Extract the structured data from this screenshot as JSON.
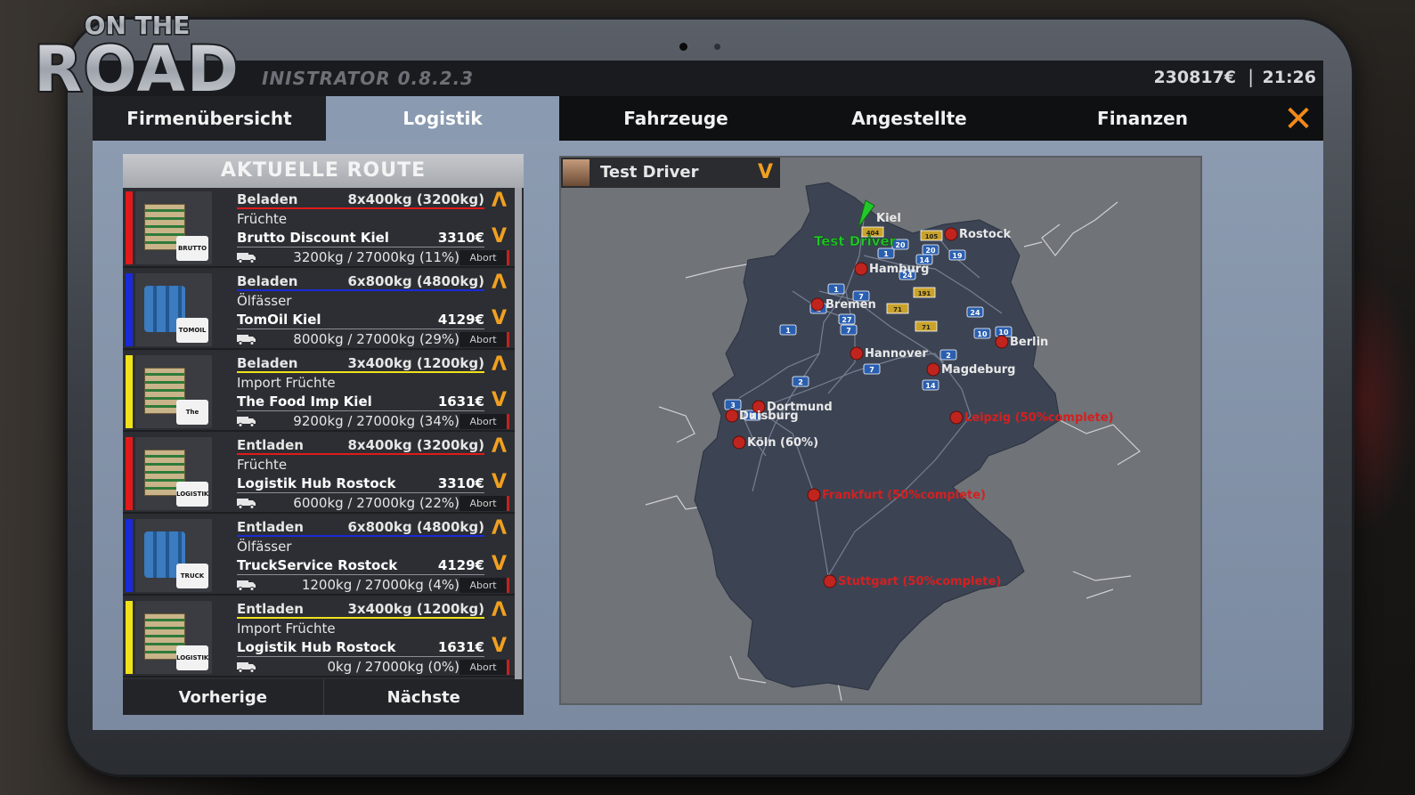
{
  "app": {
    "logo_top": "ON THE",
    "logo_main": "ROAD",
    "title": "INISTRATOR 0.8.2.3",
    "money": "230817€",
    "separator": "|",
    "clock": "21:26"
  },
  "tabs": [
    {
      "label": "Firmenübersicht"
    },
    {
      "label": "Logistik"
    },
    {
      "label": "Fahrzeuge"
    },
    {
      "label": "Angestellte"
    },
    {
      "label": "Finanzen"
    }
  ],
  "close_icon": "✕",
  "route": {
    "title": "AKTUELLE ROUTE",
    "items": [
      {
        "action": "Beladen",
        "qty": "8x400kg (3200kg)",
        "goods": "Früchte",
        "company": "Brutto Discount Kiel",
        "price": "3310€",
        "load": "3200kg / 27000kg (11%)",
        "abort": "Abort",
        "color": "#e01a1a",
        "cargo": "crate",
        "logo": "BRUTTO"
      },
      {
        "action": "Beladen",
        "qty": "6x800kg (4800kg)",
        "goods": "Ölfässer",
        "company": "TomOil Kiel",
        "price": "4129€",
        "load": "8000kg / 27000kg (29%)",
        "abort": "Abort",
        "color": "#1a2ad8",
        "cargo": "barrel",
        "logo": "TOMOIL"
      },
      {
        "action": "Beladen",
        "qty": "3x400kg (1200kg)",
        "goods": "Import Früchte",
        "company": "The Food Imp Kiel",
        "price": "1631€",
        "load": "9200kg / 27000kg (34%)",
        "abort": "Abort",
        "color": "#f0e21a",
        "cargo": "crate",
        "logo": "The Food Imp"
      },
      {
        "action": "Entladen",
        "qty": "8x400kg (3200kg)",
        "goods": "Früchte",
        "company": "Logistik Hub Rostock",
        "price": "3310€",
        "load": "6000kg / 27000kg (22%)",
        "abort": "Abort",
        "color": "#e01a1a",
        "cargo": "crate",
        "logo": "LOGISTIK HUB"
      },
      {
        "action": "Entladen",
        "qty": "6x800kg (4800kg)",
        "goods": "Ölfässer",
        "company": "TruckService Rostock",
        "price": "4129€",
        "load": "1200kg / 27000kg (4%)",
        "abort": "Abort",
        "color": "#1a2ad8",
        "cargo": "barrel",
        "logo": "TRUCK SERVICE"
      },
      {
        "action": "Entladen",
        "qty": "3x400kg (1200kg)",
        "goods": "Import Früchte",
        "company": "Logistik Hub Rostock",
        "price": "1631€",
        "load": "0kg / 27000kg (0%)",
        "abort": "Abort",
        "color": "#f0e21a",
        "cargo": "crate",
        "logo": "LOGISTIK HUB"
      }
    ],
    "prev": "Vorherige",
    "next": "Nächste"
  },
  "driver": {
    "name": "Test Driver",
    "arrow": "V"
  },
  "map": {
    "driver_label": "Test Driver",
    "cities": [
      {
        "name": "Kiel"
      },
      {
        "name": "Rostock"
      },
      {
        "name": "Hamburg"
      },
      {
        "name": "Bremen"
      },
      {
        "name": "Berlin"
      },
      {
        "name": "Hannover"
      },
      {
        "name": "Magdeburg"
      },
      {
        "name": "Dortmund"
      },
      {
        "name": "Duisburg"
      },
      {
        "name": "Köln (60%)"
      },
      {
        "name": "Leipzig (50%complete)"
      },
      {
        "name": "Frankfurt (50%complete)"
      },
      {
        "name": "Stuttgart (50%complete)"
      }
    ],
    "highways_blue": [
      "1",
      "20",
      "20",
      "14",
      "19",
      "24",
      "1",
      "7",
      "1",
      "27",
      "7",
      "1",
      "24",
      "10",
      "10",
      "2",
      "7",
      "14",
      "2",
      "3",
      "4"
    ],
    "highways_yellow": [
      "404",
      "105",
      "191",
      "71",
      "71"
    ]
  },
  "colors": {
    "accent": "#f0a020",
    "close": "#f08a1a",
    "active_tab": "#8a9ab0",
    "city_marker": "#c0241e",
    "map_land": "#3d4556",
    "highway_blue": "#2a5fb0",
    "highway_yellow": "#c9a22a",
    "driver_green": "#22c82a"
  }
}
